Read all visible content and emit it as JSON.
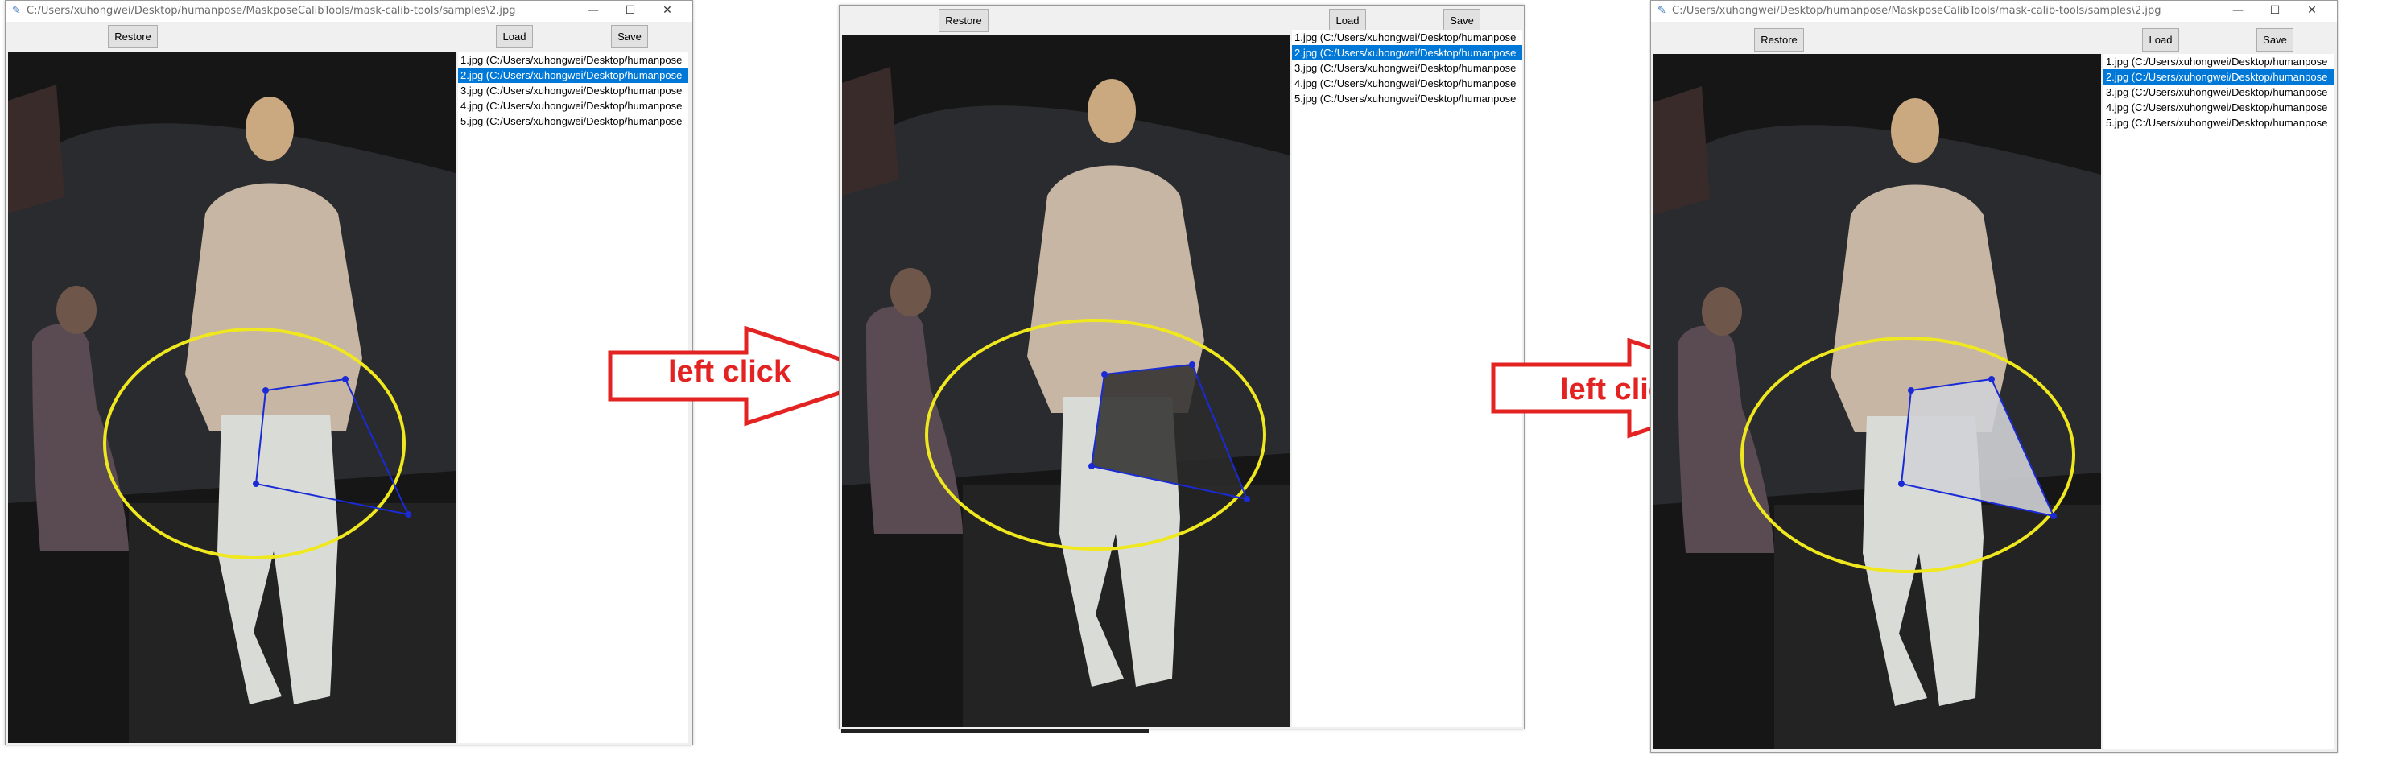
{
  "annotations": {
    "arrow1_label": "left click",
    "arrow2_label": "left click",
    "highlight_color": "#f0e81e",
    "arrow_color": "#e32222",
    "keypoint_color": "#1a2bd6"
  },
  "windows": [
    {
      "title": "C:/Users/xuhongwei/Desktop/humanpose/MaskposeCalibTools/mask-calib-tools/samples\\2.jpg",
      "buttons": {
        "restore": "Restore",
        "load": "Load",
        "save": "Save"
      },
      "controls": {
        "minimize": "—",
        "maximize": "☐",
        "close": "✕"
      },
      "files": [
        "1.jpg (C:/Users/xuhongwei/Desktop/humanpose",
        "2.jpg (C:/Users/xuhongwei/Desktop/humanpose",
        "3.jpg (C:/Users/xuhongwei/Desktop/humanpose",
        "4.jpg (C:/Users/xuhongwei/Desktop/humanpose",
        "5.jpg (C:/Users/xuhongwei/Desktop/humanpose"
      ],
      "selected_index": 1
    },
    {
      "buttons": {
        "restore": "Restore",
        "load": "Load",
        "save": "Save"
      },
      "files": [
        "1.jpg (C:/Users/xuhongwei/Desktop/humanpose",
        "2.jpg (C:/Users/xuhongwei/Desktop/humanpose",
        "3.jpg (C:/Users/xuhongwei/Desktop/humanpose",
        "4.jpg (C:/Users/xuhongwei/Desktop/humanpose",
        "5.jpg (C:/Users/xuhongwei/Desktop/humanpose"
      ],
      "selected_index": 1
    },
    {
      "title": "C:/Users/xuhongwei/Desktop/humanpose/MaskposeCalibTools/mask-calib-tools/samples\\2.jpg",
      "buttons": {
        "restore": "Restore",
        "load": "Load",
        "save": "Save"
      },
      "controls": {
        "minimize": "—",
        "maximize": "☐",
        "close": "✕"
      },
      "files": [
        "1.jpg (C:/Users/xuhongwei/Desktop/humanpose",
        "2.jpg (C:/Users/xuhongwei/Desktop/humanpose",
        "3.jpg (C:/Users/xuhongwei/Desktop/humanpose",
        "4.jpg (C:/Users/xuhongwei/Desktop/humanpose",
        "5.jpg (C:/Users/xuhongwei/Desktop/humanpose"
      ],
      "selected_index": 1
    }
  ]
}
